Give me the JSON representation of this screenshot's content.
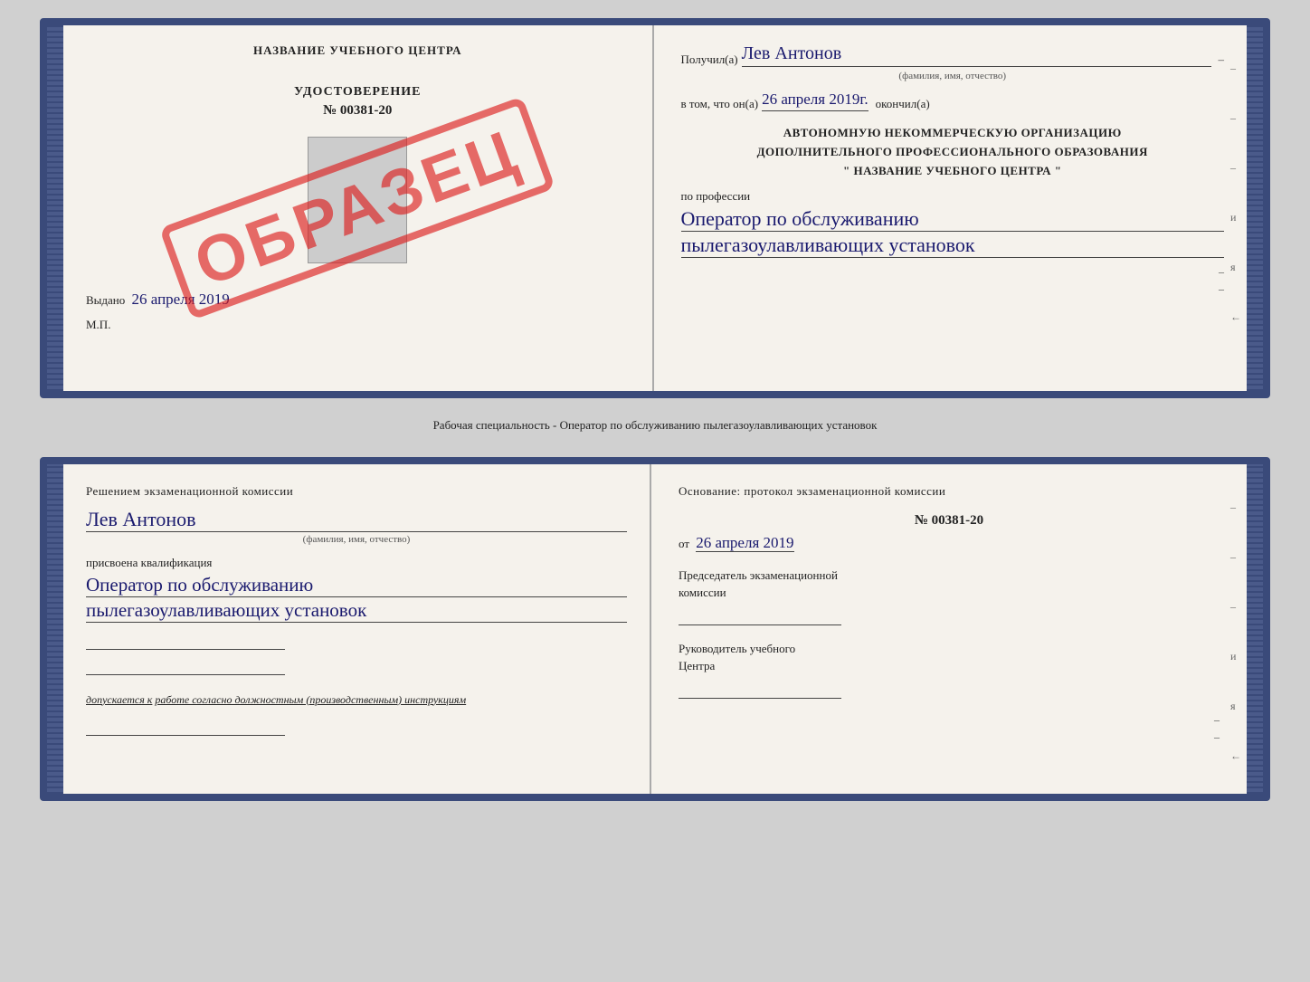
{
  "top_book": {
    "left": {
      "title": "НАЗВАНИЕ УЧЕБНОГО ЦЕНТРА",
      "udostoverenie_label": "УДОСТОВЕРЕНИЕ",
      "number": "№ 00381-20",
      "stamp": "ОБРАЗЕЦ",
      "vydano_label": "Выдано",
      "vydano_date": "26 апреля 2019",
      "mp_label": "М.П."
    },
    "right": {
      "poluchil_label": "Получил(а)",
      "poluchil_name": "Лев Антонов",
      "poluchil_subtitle": "(фамилия, имя, отчество)",
      "vtom_label": "в том, что он(а)",
      "vtom_date": "26 апреля 2019г.",
      "okonchil_label": "окончил(а)",
      "org_line1": "АВТОНОМНУЮ НЕКОММЕРЧЕСКУЮ ОРГАНИЗАЦИЮ",
      "org_line2": "ДОПОЛНИТЕЛЬНОГО ПРОФЕССИОНАЛЬНОГО ОБРАЗОВАНИЯ",
      "org_line3": "\"  НАЗВАНИЕ УЧЕБНОГО ЦЕНТРА  \"",
      "po_professii_label": "по профессии",
      "profession_line1": "Оператор по обслуживанию",
      "profession_line2": "пылегазоулавливающих установок",
      "dash1": "–",
      "dash2": "–",
      "dash3": "–",
      "letter_i": "и",
      "letter_ya": "я",
      "arrow": "←"
    }
  },
  "middle_text": "Рабочая специальность - Оператор по обслуживанию пылегазоулавливающих установок",
  "bottom_book": {
    "left": {
      "resheniem_label": "Решением экзаменационной комиссии",
      "name": "Лев Антонов",
      "name_subtitle": "(фамилия, имя, отчество)",
      "prisvoena_label": "присвоена квалификация",
      "kvalif_line1": "Оператор по обслуживанию",
      "kvalif_line2": "пылегазоулавливающих установок",
      "line1": "___________________________",
      "line2": "___________________________",
      "dopuskaetsya_label": "допускается к",
      "dopuskaetsya_text": "работе согласно должностным (производственным) инструкциям",
      "line3": "___________________________"
    },
    "right": {
      "osnovanie_label": "Основание: протокол экзаменационной комиссии",
      "protocol_number": "№ 00381-20",
      "protocol_ot": "от",
      "protocol_date": "26 апреля 2019",
      "predsedatel_label": "Председатель экзаменационной",
      "predsedatel_label2": "комиссии",
      "rukovoditel_label": "Руководитель учебного",
      "rukovoditel_label2": "Центра",
      "dash1": "–",
      "dash2": "–",
      "dash3": "–",
      "letter_i": "и",
      "letter_ya": "я",
      "arrow": "←"
    }
  }
}
